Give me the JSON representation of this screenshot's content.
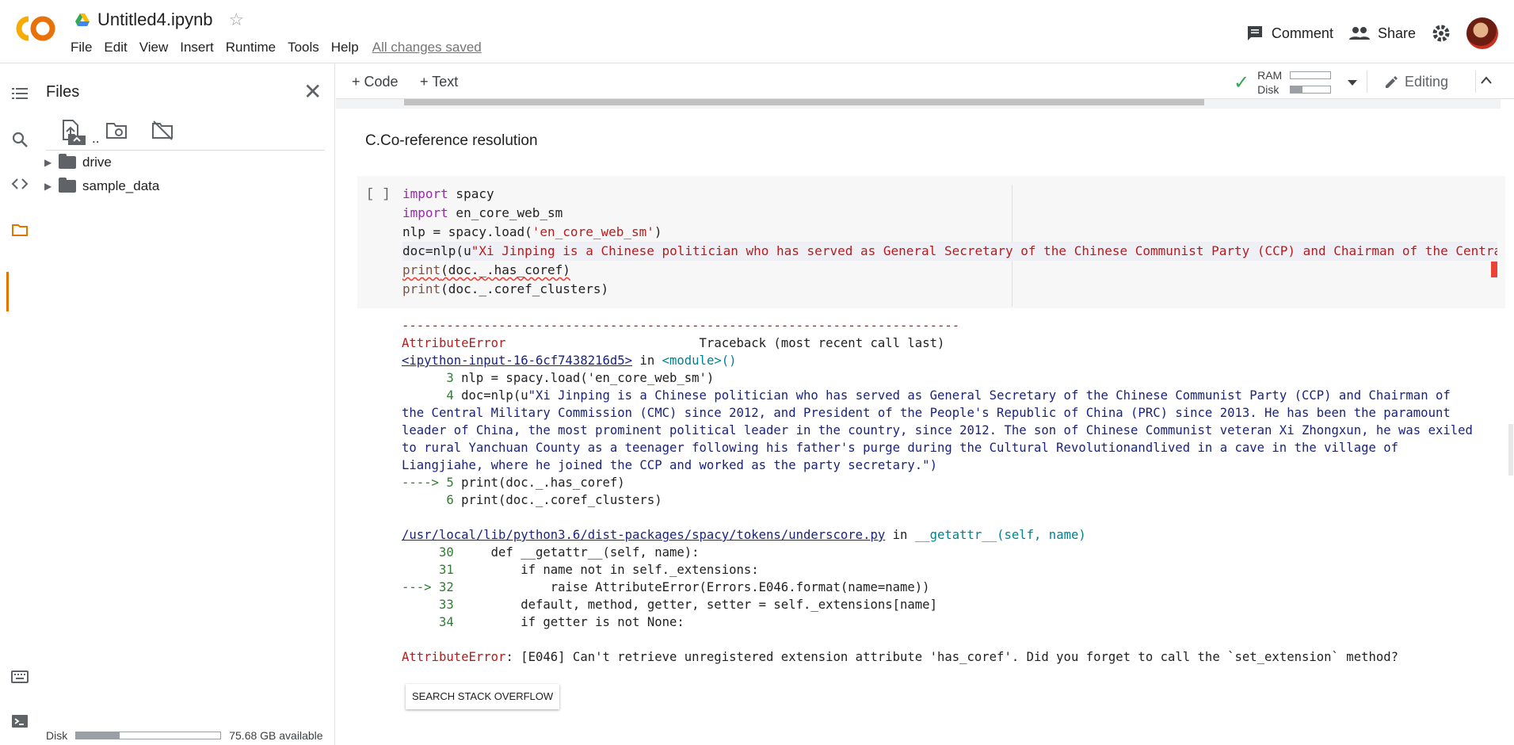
{
  "app": {
    "title": "Untitled4.ipynb",
    "menu": [
      "File",
      "Edit",
      "View",
      "Insert",
      "Runtime",
      "Tools",
      "Help"
    ],
    "save_status": "All changes saved",
    "comment_label": "Comment",
    "share_label": "Share"
  },
  "files": {
    "title": "Files",
    "tree": [
      {
        "name": "..",
        "icon": "folder-up-icon"
      },
      {
        "name": "drive",
        "icon": "folder-icon"
      },
      {
        "name": "sample_data",
        "icon": "folder-icon"
      }
    ],
    "disk_label": "Disk",
    "disk_available": "75.68 GB available",
    "disk_used_fraction": 0.3
  },
  "toolbar": {
    "code_label": "+ Code",
    "text_label": "+ Text",
    "ram_label": "RAM",
    "disk_label": "Disk",
    "ram_used_fraction": 0.0,
    "disk_used_fraction": 0.3,
    "editing_label": "Editing"
  },
  "notebook": {
    "section_heading": "C.Co-reference resolution",
    "cell_run_label": "[ ]",
    "code_lines": [
      "import spacy",
      "import en_core_web_sm",
      "nlp = spacy.load('en_core_web_sm')",
      "doc=nlp(u\"Xi Jinping is a Chinese politician who has served as General Secretary of the Chinese Communist Party (CCP) and Chairman of the Centra",
      "print(doc._.has_coref)",
      "print(doc._.coref_clusters)"
    ],
    "output": {
      "dashes": "---------------------------------------------------------------------------",
      "error_type": "AttributeError",
      "traceback_header": "Traceback (most recent call last)",
      "input_link": "<ipython-input-16-6cf7438216d5>",
      "in_word": "in",
      "module": "<module>()",
      "lines": [
        "      3 nlp = spacy.load('en_core_web_sm')",
        "      4 doc=nlp(u\"Xi Jinping is a Chinese politician who has served as General Secretary of the Chinese Communist Party (CCP) and Chairman of",
        "the Central Military Commission (CMC) since 2012, and President of the People's Republic of China (PRC) since 2013. He has been the paramount",
        "leader of China, the most prominent political leader in the country, since 2012. The son of Chinese Communist veteran Xi Zhongxun, he was exiled",
        "to rural Yanchuan County as a teenager following his father's purge during the Cultural Revolutionandlived in a cave in the village of",
        "Liangjiahe, where he joined the CCP and worked as the party secretary.\")",
        "----> 5 print(doc._.has_coref)",
        "      6 print(doc._.coref_clusters)"
      ],
      "file_link": "/usr/local/lib/python3.6/dist-packages/spacy/tokens/underscore.py",
      "file_func": "__getattr__(self, name)",
      "lines2": [
        "     30     def __getattr__(self, name):",
        "     31         if name not in self._extensions:",
        "---> 32             raise AttributeError(Errors.E046.format(name=name))",
        "     33         default, method, getter, setter = self._extensions[name]",
        "     34         if getter is not None:"
      ],
      "final_error_type": "AttributeError",
      "final_error_msg": ": [E046] Can't retrieve unregistered extension attribute 'has_coref'. Did you forget to call the `set_extension` method?",
      "so_button": "SEARCH STACK OVERFLOW"
    }
  }
}
